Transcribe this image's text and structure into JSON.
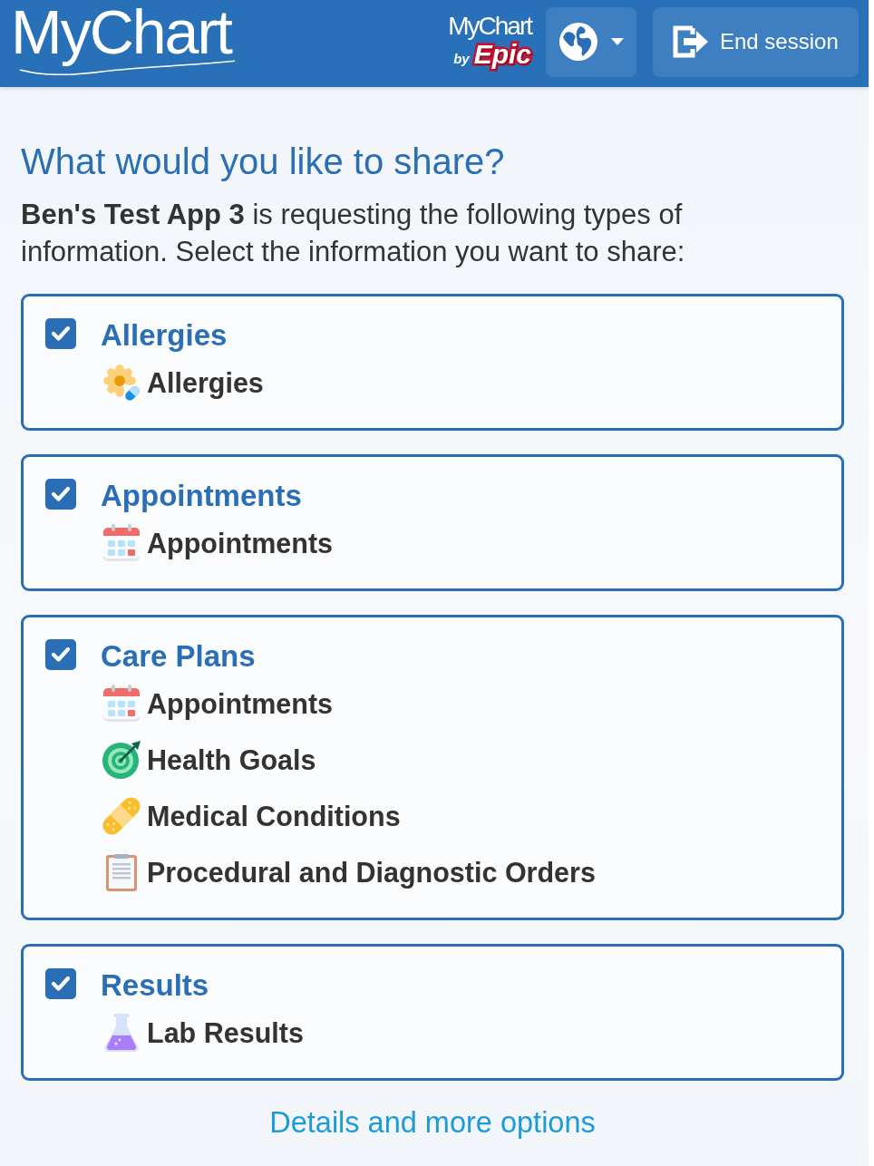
{
  "header": {
    "logo": "MyChart",
    "partner_logo": {
      "name": "MyChart",
      "by": "by",
      "brand": "Epic"
    },
    "end_session": "End session"
  },
  "title": "What would you like to share?",
  "intro": "**Ben's Test App 3** is requesting the following types of information. Select the information you want to share:",
  "categories": [
    {
      "title": "Allergies",
      "checked": true,
      "items": [
        {
          "label": "Allergies",
          "kind": "allergy"
        }
      ]
    },
    {
      "title": "Appointments",
      "checked": true,
      "items": [
        {
          "label": "Appointments",
          "kind": "calendar"
        }
      ]
    },
    {
      "title": "Care Plans",
      "checked": true,
      "items": [
        {
          "label": "Appointments",
          "kind": "calendar"
        },
        {
          "label": "Health Goals",
          "kind": "target"
        },
        {
          "label": "Medical Conditions",
          "kind": "bandage"
        },
        {
          "label": "Procedural and Diagnostic Orders",
          "kind": "clipboard"
        }
      ]
    },
    {
      "title": "Results",
      "checked": true,
      "items": [
        {
          "label": "Lab Results",
          "kind": "flask"
        }
      ]
    }
  ],
  "details_link": "Details and more options"
}
